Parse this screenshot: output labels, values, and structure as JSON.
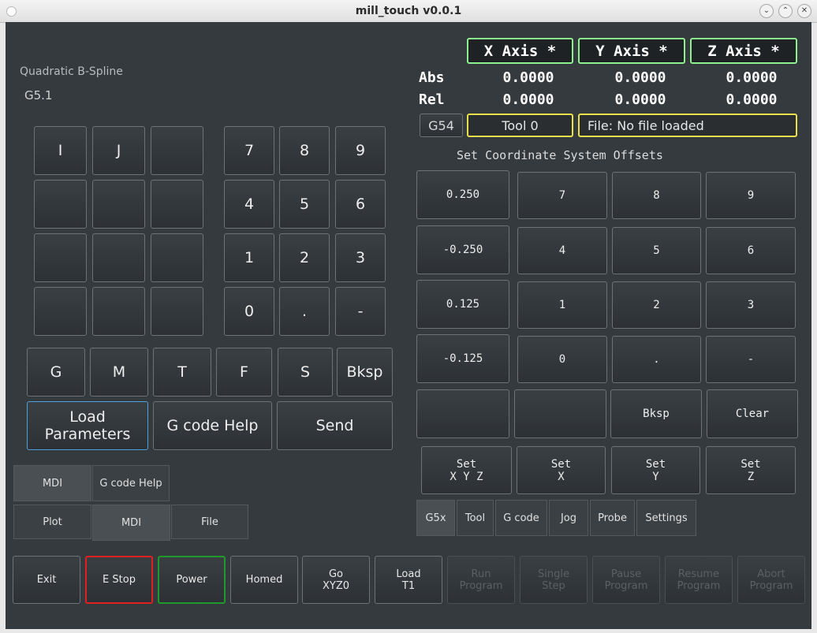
{
  "window": {
    "title": "mill_touch v0.0.1",
    "controls": [
      "⌄",
      "⌃",
      "✕"
    ]
  },
  "mdi": {
    "gcode_name": "Quadratic B-Spline",
    "gcode": "G5.1"
  },
  "letter_keys": [
    "I",
    "J",
    "",
    "",
    "",
    "",
    "",
    "",
    "",
    "",
    "",
    ""
  ],
  "numpad": [
    "7",
    "8",
    "9",
    "4",
    "5",
    "6",
    "1",
    "2",
    "3",
    "0",
    ".",
    "-"
  ],
  "word_keys": [
    "G",
    "M",
    "T",
    "F",
    "S",
    "Bksp"
  ],
  "action_buttons": {
    "load": "Load\nParameters",
    "help": "G code Help",
    "send": "Send"
  },
  "left_tabs_row1": [
    "MDI",
    "G code Help"
  ],
  "left_tabs_row2": [
    "Plot",
    "MDI",
    "File"
  ],
  "dro": {
    "axes": [
      "X Axis *",
      "Y Axis *",
      "Z Axis *"
    ],
    "abs_label": "Abs",
    "rel_label": "Rel",
    "abs": [
      "0.0000",
      "0.0000",
      "0.0000"
    ],
    "rel": [
      "0.0000",
      "0.0000",
      "0.0000"
    ]
  },
  "status": {
    "coord_system": "G54",
    "tool": "Tool 0",
    "file": "File: No file loaded"
  },
  "offsets": {
    "title": "Set Coordinate System Offsets",
    "presets": [
      "0.250",
      "-0.250",
      "0.125",
      "-0.125"
    ],
    "numpad": [
      "7",
      "8",
      "9",
      "4",
      "5",
      "6",
      "1",
      "2",
      "3",
      "0",
      ".",
      "-"
    ],
    "edit_row": [
      "",
      "",
      "Bksp",
      "Clear"
    ],
    "set_buttons": [
      "Set\nX Y Z",
      "Set\nX",
      "Set\nY",
      "Set\nZ"
    ]
  },
  "right_tabs": [
    "G5x",
    "Tool",
    "G code",
    "Jog",
    "Probe",
    "Settings"
  ],
  "bottom_controls": [
    {
      "label": "Exit",
      "state": "normal"
    },
    {
      "label": "E Stop",
      "state": "estop"
    },
    {
      "label": "Power",
      "state": "power"
    },
    {
      "label": "Homed",
      "state": "normal"
    },
    {
      "label": "Go\nXYZ0",
      "state": "normal"
    },
    {
      "label": "Load\nT1",
      "state": "normal"
    },
    {
      "label": "Run\nProgram",
      "state": "disabled"
    },
    {
      "label": "Single\nStep",
      "state": "disabled"
    },
    {
      "label": "Pause\nProgram",
      "state": "disabled"
    },
    {
      "label": "Resume\nProgram",
      "state": "disabled"
    },
    {
      "label": "Abort\nProgram",
      "state": "disabled"
    }
  ],
  "colors": {
    "background": "#353a3e",
    "axis_border": "#8cf08c",
    "status_border": "#e8e04a",
    "estop_border": "#e02020",
    "power_border": "#1f9a2a",
    "focus_border": "#4aa3d8"
  }
}
